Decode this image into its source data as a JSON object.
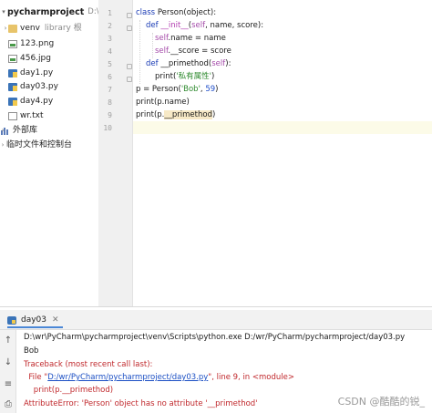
{
  "project_tree": {
    "root": {
      "name": "pycharmproject",
      "path": "D:\\wr\\"
    },
    "items": [
      {
        "label": "venv",
        "note": "library 根",
        "icon": "folder-icon"
      },
      {
        "label": "123.png",
        "icon": "image-file-icon"
      },
      {
        "label": "456.jpg",
        "icon": "image-file-icon"
      },
      {
        "label": "day1.py",
        "icon": "python-file-icon"
      },
      {
        "label": "day03.py",
        "icon": "python-file-icon"
      },
      {
        "label": "day4.py",
        "icon": "python-file-icon"
      },
      {
        "label": "wr.txt",
        "icon": "text-file-icon"
      }
    ],
    "external_libraries": "外部库",
    "scratches": "临时文件和控制台"
  },
  "editor": {
    "line_numbers": [
      "1",
      "2",
      "3",
      "4",
      "5",
      "6",
      "7",
      "8",
      "9",
      "10"
    ],
    "code": {
      "l1": {
        "kw": "class ",
        "name": "Person(object):"
      },
      "l2": {
        "kw": "def ",
        "name": "__init__",
        "open": "(",
        "self": "self",
        "rest": ", name, score):"
      },
      "l3": {
        "self": "self",
        "rest": ".name = name"
      },
      "l4": {
        "self": "self",
        "rest": ".__score = score"
      },
      "l5": {
        "kw": "def ",
        "name": "__primethod",
        "open": "(",
        "self": "self",
        "close": "):"
      },
      "l6": {
        "fn": "print(",
        "str": "'私有属性'",
        "close": ")"
      },
      "l7": {
        "pre": "p = Person(",
        "str": "'Bob'",
        "sep": ", ",
        "num": "59",
        "close": ")"
      },
      "l8": {
        "text": "print(p.name)"
      },
      "l9": {
        "pre": "print(p.",
        "dunder": "__primethod",
        "close": ")"
      }
    }
  },
  "run_panel": {
    "tab_label": "day03",
    "console": {
      "cmd": "D:\\wr\\PyCharm\\pycharmproject\\venv\\Scripts\\python.exe D:/wr/PyCharm/pycharmproject/day03.py",
      "out": "Bob",
      "tb_head": "Traceback (most recent call last):",
      "tb_file_pre": "  File \"",
      "tb_file_link": "D:/wr/PyCharm/pycharmproject/day03.py",
      "tb_file_post": "\", line 9, in <module>",
      "tb_code": "    print(p.__primethod)",
      "error": "AttributeError: 'Person' object has no attribute '__primethod'"
    }
  },
  "watermark": "CSDN @酷酷的锐_"
}
